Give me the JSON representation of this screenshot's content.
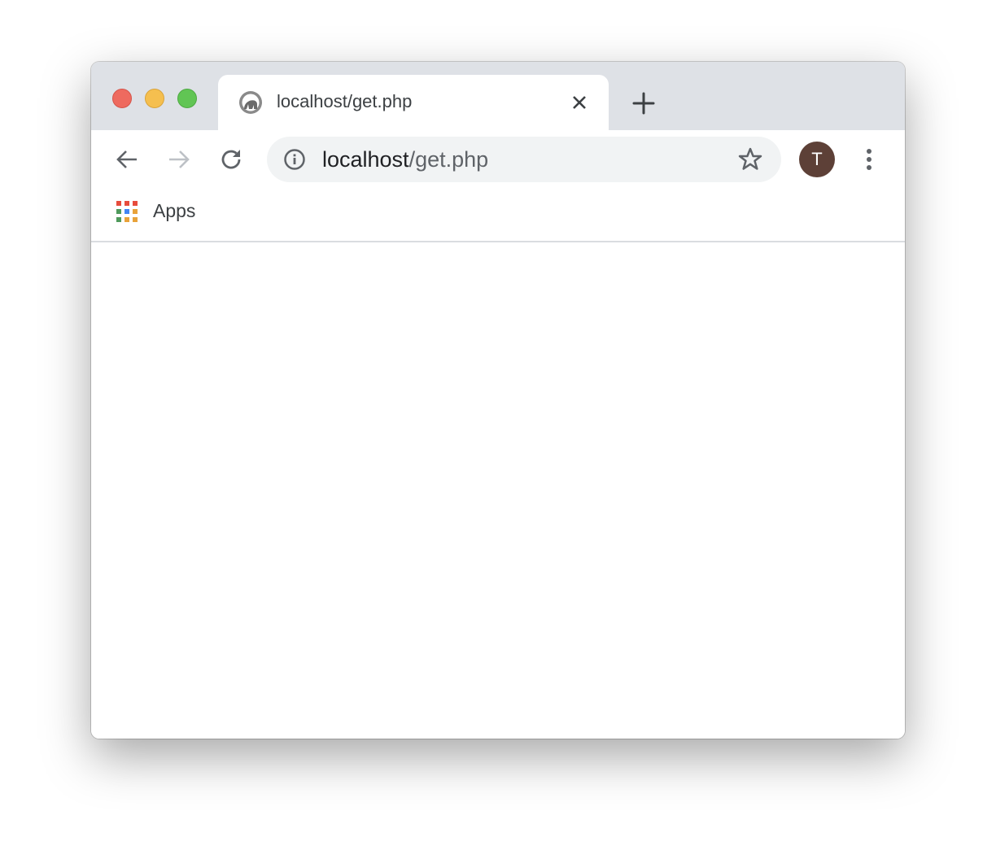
{
  "window": {
    "traffic_lights": [
      {
        "name": "close",
        "color": "#ee6a5f"
      },
      {
        "name": "minimize",
        "color": "#f5bf4f"
      },
      {
        "name": "maximize",
        "color": "#61c554"
      }
    ]
  },
  "tab": {
    "title": "localhost/get.php",
    "favicon": "globe-icon",
    "close_icon": "close-icon"
  },
  "new_tab_icon": "plus-icon",
  "toolbar": {
    "back_icon": "arrow-left-icon",
    "forward_icon": "arrow-right-icon",
    "reload_icon": "reload-icon",
    "url_host": "localhost",
    "url_path": "/get.php",
    "info_icon": "info-icon",
    "bookmark_icon": "star-icon",
    "avatar_letter": "T",
    "avatar_color": "#5d4037",
    "menu_icon": "kebab-menu-icon"
  },
  "bookmarks": {
    "apps_label": "Apps",
    "apps_icon": "apps-grid-icon"
  }
}
